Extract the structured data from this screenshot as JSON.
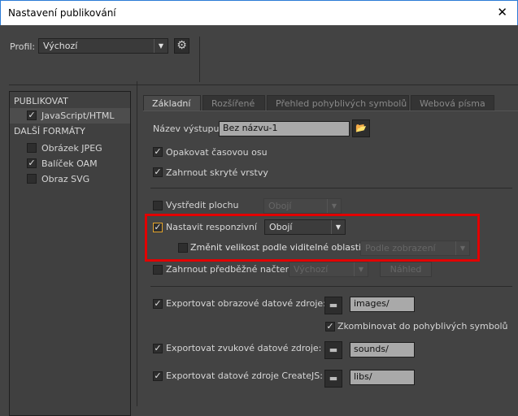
{
  "window": {
    "title": "Nastavení publikování",
    "close": "✕"
  },
  "profile": {
    "label": "Profil:",
    "value": "Výchozí"
  },
  "sidebar": {
    "publish_header": "PUBLIKOVAT",
    "publish_items": [
      {
        "label": "JavaScript/HTML",
        "checked": true
      }
    ],
    "other_header": "DALŠÍ FORMÁTY",
    "other_items": [
      {
        "label": "Obrázek JPEG",
        "checked": false
      },
      {
        "label": "Balíček OAM",
        "checked": true
      },
      {
        "label": "Obraz SVG",
        "checked": false
      }
    ]
  },
  "tabs": [
    "Základní",
    "Rozšířené",
    "Přehled pohyblivých symbolů",
    "Webová písma"
  ],
  "basic": {
    "output_label": "Název výstupu:",
    "output_value": "Bez názvu-1",
    "loop": "Opakovat časovou osu",
    "hidden": "Zahrnout skryté vrstvy",
    "center": "Vystředit plochu",
    "center_value": "Obojí",
    "responsive": "Nastavit responzivní",
    "responsive_value": "Obojí",
    "scale": "Změnit velikost podle viditelné oblasti",
    "scale_value": "Podle zobrazení",
    "preloader": "Zahrnout předběžné načtení",
    "preloader_value": "Výchozí",
    "preview": "Náhled",
    "export_images": "Exportovat obrazové datové zdroje:",
    "images_path": "images/",
    "combine": "Zkombinovat do pohyblivých symbolů",
    "export_sounds": "Exportovat zvukové datové zdroje:",
    "sounds_path": "sounds/",
    "export_createjs": "Exportovat datové zdroje CreateJS:",
    "libs_path": "libs/"
  },
  "highlight_color": "#e30000"
}
